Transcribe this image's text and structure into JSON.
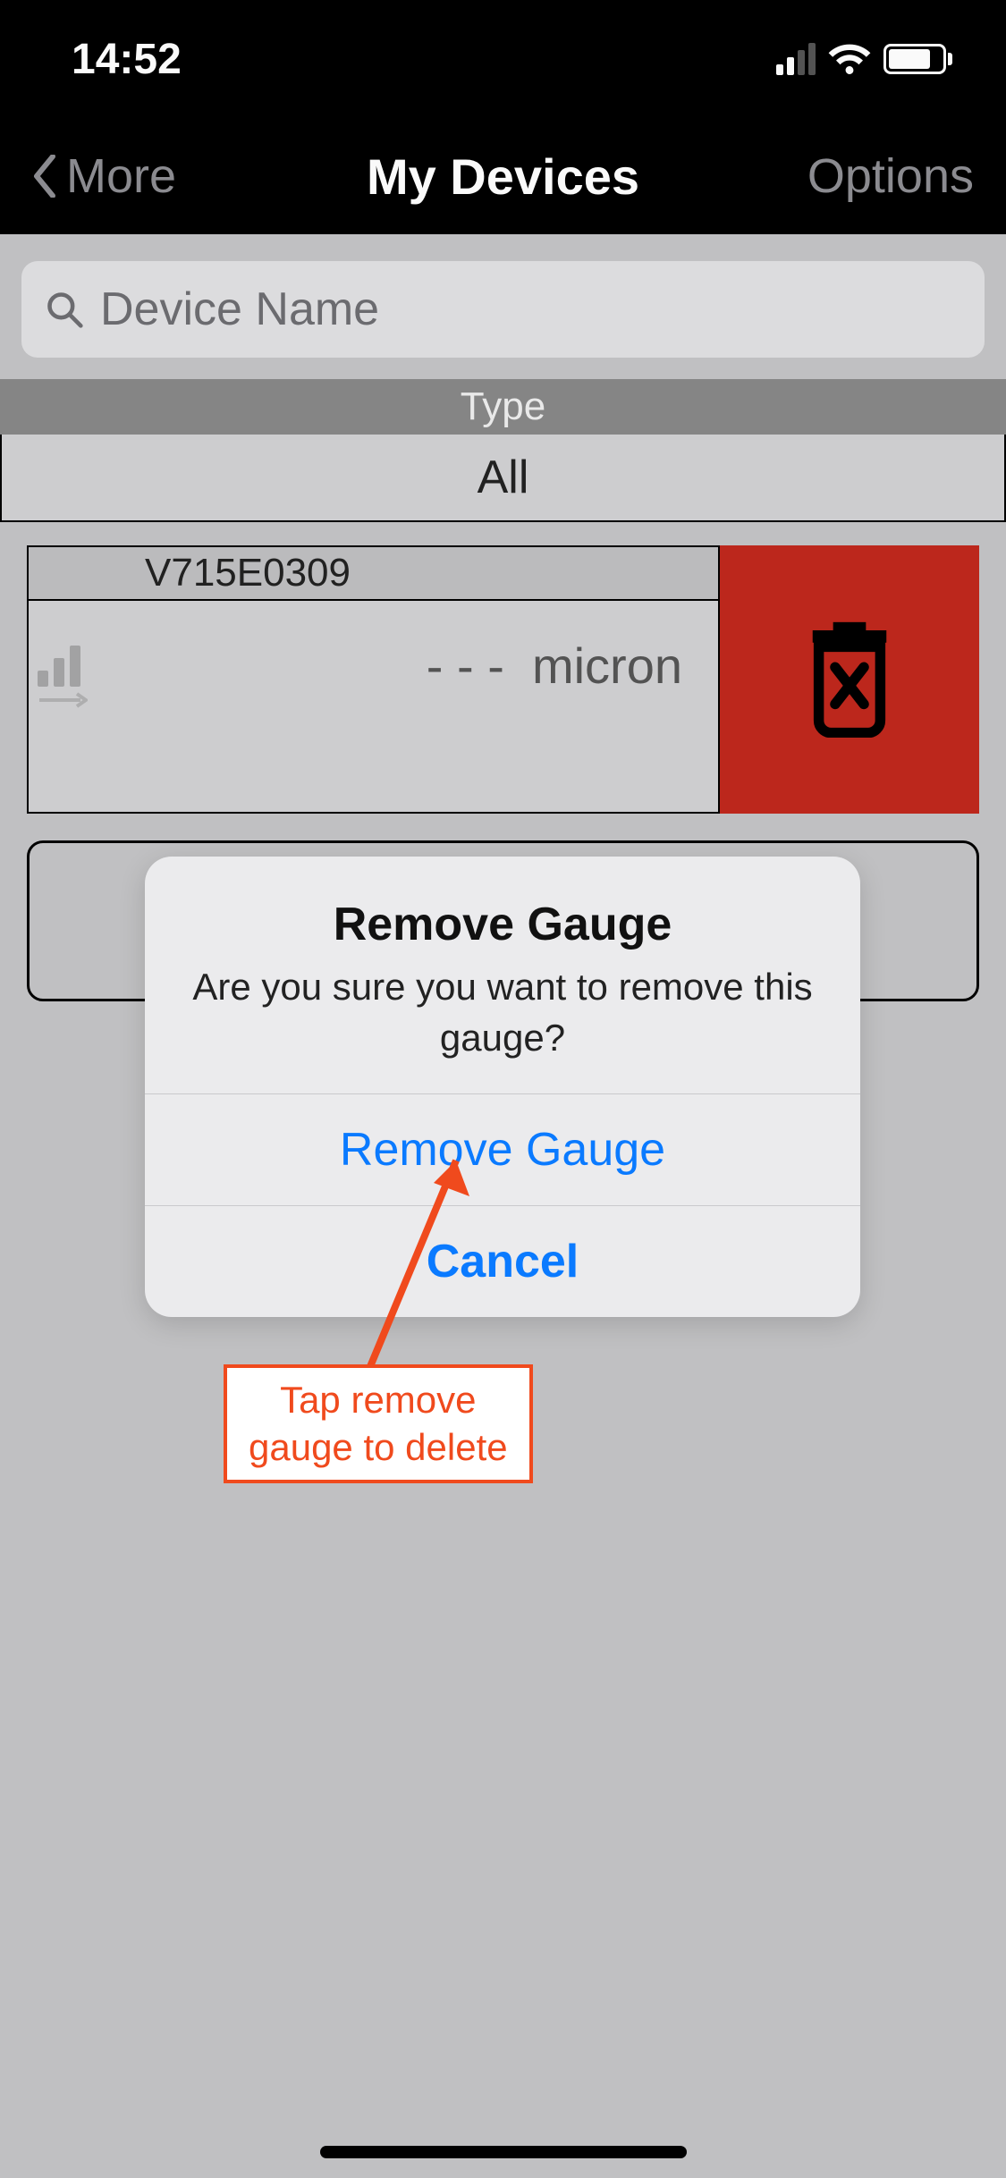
{
  "status": {
    "time": "14:52"
  },
  "nav": {
    "back": "More",
    "title": "My Devices",
    "options": "Options"
  },
  "search": {
    "placeholder": "Device Name"
  },
  "typeSection": {
    "header": "Type",
    "value": "All"
  },
  "device": {
    "id": "V715E0309",
    "value": "- - -",
    "unit": "micron"
  },
  "alert": {
    "title": "Remove Gauge",
    "message": "Are you sure you want to remove this gauge?",
    "confirm": "Remove Gauge",
    "cancel": "Cancel"
  },
  "annotation": {
    "text_line1": "Tap remove",
    "text_line2": "gauge to delete"
  }
}
